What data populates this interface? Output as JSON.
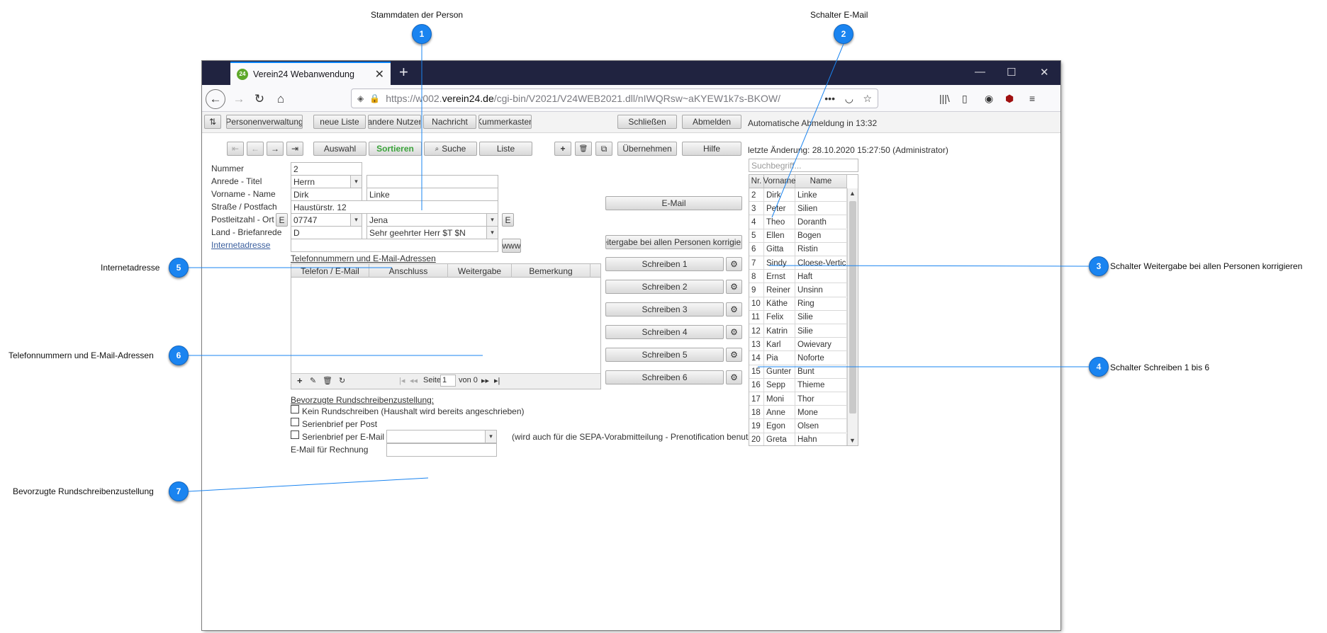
{
  "annotations": [
    {
      "n": "1",
      "text": "Stammdaten der Person"
    },
    {
      "n": "2",
      "text": "Schalter E-Mail"
    },
    {
      "n": "3",
      "text": "Schalter Weitergabe bei allen Personen korrigieren"
    },
    {
      "n": "4",
      "text": "Schalter Schreiben 1 bis 6"
    },
    {
      "n": "5",
      "text": "Internetadresse"
    },
    {
      "n": "6",
      "text": "Telefonnummern und E-Mail-Adressen"
    },
    {
      "n": "7",
      "text": "Bevorzugte Rundschreibenzustellung"
    }
  ],
  "browser": {
    "tab_title": "Verein24 Webanwendung",
    "tab_favicon": "24",
    "url_prefix": "https://w002.",
    "url_domain": "verein24.de",
    "url_path": "/cgi-bin/V2021/V24WEB2021.dll/nIWQRsw~aKYEW1k7s-BKOW/",
    "win_min": "—",
    "win_max": "☐",
    "win_close": "✕",
    "dots": "•••"
  },
  "toolbar": {
    "sidebar_toggle": "⇅",
    "personenverwaltung": "Personenverwaltung",
    "neue_liste": "neue Liste",
    "andere_nutzer": "andere Nutzer",
    "nachricht": "Nachricht",
    "kummerkasten": "Kummerkasten",
    "schliessen": "Schließen",
    "abmelden": "Abmelden",
    "auto_logout": "Automatische Abmeldung in 13:32"
  },
  "toolbar2": {
    "first": "⇤",
    "prev": "←",
    "next": "→",
    "last": "⇥",
    "auswahl": "Auswahl",
    "sortieren": "Sortieren",
    "suche": "Suche",
    "liste": "Liste",
    "add": "+",
    "delete": "🗑",
    "copy": "⧉",
    "uebernehmen": "Übernehmen",
    "hilfe": "Hilfe",
    "last_change": "letzte Änderung: 28.10.2020 15:27:50 (Administrator)"
  },
  "form": {
    "nummer_label": "Nummer",
    "nummer": "2",
    "anrede_label": "Anrede - Titel",
    "anrede": "Herrn",
    "titel": "",
    "vorname_label": "Vorname - Name",
    "vorname": "Dirk",
    "name": "Linke",
    "strasse_label": "Straße / Postfach",
    "strasse": "Haustürstr. 12",
    "plz_label": "Postleitzahl - Ort",
    "plz": "07747",
    "ort": "Jena",
    "e_button": "E",
    "land_label": "Land - Briefanrede",
    "land": "D",
    "briefanrede": "Sehr geehrter Herr $T $N",
    "internet_label": "Internetadresse",
    "internet": "",
    "www": "www"
  },
  "phone": {
    "title": "Telefonnummern und E-Mail-Adressen",
    "columns": [
      "Telefon / E-Mail",
      "Anschluss",
      "Weitergabe",
      "Bemerkung"
    ],
    "seite_label": "Seite",
    "seite": "1",
    "von": "von 0"
  },
  "rundschreiben": {
    "title": "Bevorzugte Rundschreibenzustellung:",
    "opt1": "Kein Rundschreiben (Haushalt wird bereits angeschrieben)",
    "opt2": "Serienbrief per Post",
    "opt3": "Serienbrief per E-Mail",
    "sepa_note": "(wird auch für die SEPA-Vorabmitteilung - Prenotification benutzt)",
    "rechnung_label": "E-Mail für Rechnung"
  },
  "actions": {
    "email": "E-Mail",
    "weitergabe": "Weitergabe bei allen Personen korrigieren",
    "schreiben": [
      "Schreiben 1",
      "Schreiben 2",
      "Schreiben 3",
      "Schreiben 4",
      "Schreiben 5",
      "Schreiben 6"
    ],
    "gear": "⚙"
  },
  "personlist": {
    "search_placeholder": "Suchbegriff...",
    "columns": [
      "Nr.",
      "Vorname",
      "Name"
    ],
    "rows": [
      [
        "2",
        "Dirk",
        "Linke"
      ],
      [
        "3",
        "Peter",
        "Silien"
      ],
      [
        "4",
        "Theo",
        "Doranth"
      ],
      [
        "5",
        "Ellen",
        "Bogen"
      ],
      [
        "6",
        "Gitta",
        "Ristin"
      ],
      [
        "7",
        "Sindy",
        "Cloese-Vertich"
      ],
      [
        "8",
        "Ernst",
        "Haft"
      ],
      [
        "9",
        "Reiner",
        "Unsinn"
      ],
      [
        "10",
        "Käthe",
        "Ring"
      ],
      [
        "11",
        "Felix",
        "Silie"
      ],
      [
        "12",
        "Katrin",
        "Silie"
      ],
      [
        "13",
        "Karl",
        "Owievary"
      ],
      [
        "14",
        "Pia",
        "Noforte"
      ],
      [
        "15",
        "Gunter",
        "Bunt"
      ],
      [
        "16",
        "Sepp",
        "Thieme"
      ],
      [
        "17",
        "Moni",
        "Thor"
      ],
      [
        "18",
        "Anne",
        "Mone"
      ],
      [
        "19",
        "Egon",
        "Olsen"
      ],
      [
        "20",
        "Greta",
        "Hahn"
      ]
    ]
  }
}
